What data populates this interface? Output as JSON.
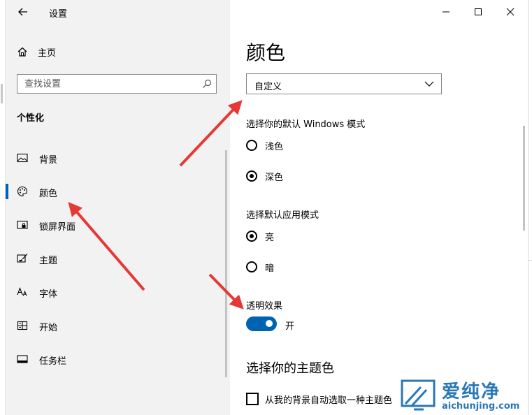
{
  "window": {
    "title": "设置",
    "controls": {
      "minimize_icon": "minimize-icon",
      "maximize_icon": "maximize-icon",
      "close_icon": "close-icon"
    }
  },
  "sidebar": {
    "home_label": "主页",
    "search_placeholder": "查找设置",
    "section_title": "个性化",
    "items": [
      {
        "label": "背景",
        "icon": "picture-icon",
        "selected": false
      },
      {
        "label": "颜色",
        "icon": "palette-icon",
        "selected": true
      },
      {
        "label": "锁屏界面",
        "icon": "lock-screen-icon",
        "selected": false
      },
      {
        "label": "主题",
        "icon": "theme-icon",
        "selected": false
      },
      {
        "label": "字体",
        "icon": "font-icon",
        "selected": false
      },
      {
        "label": "开始",
        "icon": "start-icon",
        "selected": false
      },
      {
        "label": "任务栏",
        "icon": "taskbar-icon",
        "selected": false
      }
    ]
  },
  "main": {
    "page_title": "颜色",
    "color_dropdown": {
      "selected": "自定义"
    },
    "windows_mode": {
      "label": "选择你的默认 Windows 模式",
      "options": [
        {
          "label": "浅色",
          "checked": false
        },
        {
          "label": "深色",
          "checked": true
        }
      ]
    },
    "app_mode": {
      "label": "选择默认应用模式",
      "options": [
        {
          "label": "亮",
          "checked": true
        },
        {
          "label": "暗",
          "checked": false
        }
      ]
    },
    "transparency": {
      "label": "透明效果",
      "state_label": "开",
      "on": true
    },
    "accent": {
      "title": "选择你的主题色",
      "auto_pick_label": "从我的背景自动选取一种主题色",
      "auto_pick_checked": false
    }
  },
  "watermark": {
    "brand_cn": "爱纯净",
    "domain": "aichunjing.com"
  },
  "colors": {
    "accent": "#0063b1",
    "sidebar_bg": "#f2f2f2",
    "annotation_arrow": "#e53935",
    "watermark": "#2a78b6"
  }
}
